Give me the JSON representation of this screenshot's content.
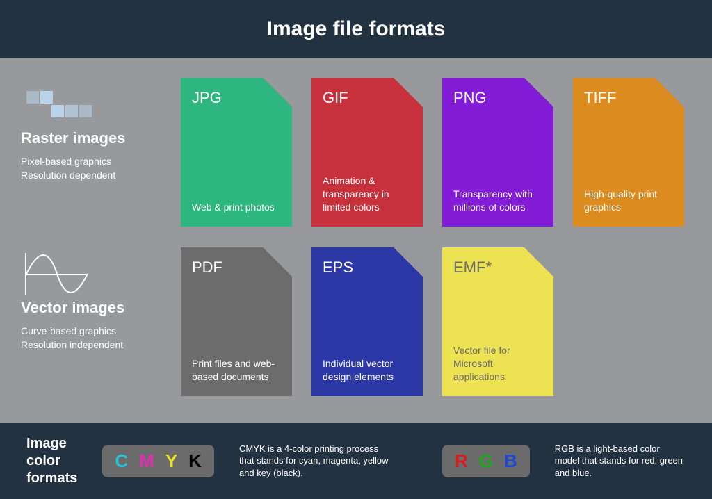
{
  "title": "Image file formats",
  "categories": {
    "raster": {
      "heading": "Raster images",
      "line1": "Pixel-based graphics",
      "line2": "Resolution dependent"
    },
    "vector": {
      "heading": "Vector images",
      "line1": "Curve-based graphics",
      "line2": "Resolution independent"
    }
  },
  "formats": {
    "jpg": {
      "label": "JPG",
      "desc": "Web & print photos"
    },
    "gif": {
      "label": "GIF",
      "desc": "Animation & transparency in limited colors"
    },
    "png": {
      "label": "PNG",
      "desc": "Transparency with millions of colors"
    },
    "tiff": {
      "label": "TIFF",
      "desc": "High-quality print graphics"
    },
    "pdf": {
      "label": "PDF",
      "desc": "Print files and web-based documents"
    },
    "eps": {
      "label": "EPS",
      "desc": "Individual vector design elements"
    },
    "emf": {
      "label": "EMF*",
      "desc": "Vector file for Microsoft applications"
    }
  },
  "footer": {
    "title": "Image color formats",
    "cmyk": {
      "letters": {
        "c": "C",
        "m": "M",
        "y": "Y",
        "k": "K"
      },
      "desc": "CMYK is a 4-color printing process that stands for cyan, magenta, yellow and key (black)."
    },
    "rgb": {
      "letters": {
        "r": "R",
        "g": "G",
        "b": "B"
      },
      "desc": "RGB is a light-based color model that stands for red, green and blue."
    }
  }
}
